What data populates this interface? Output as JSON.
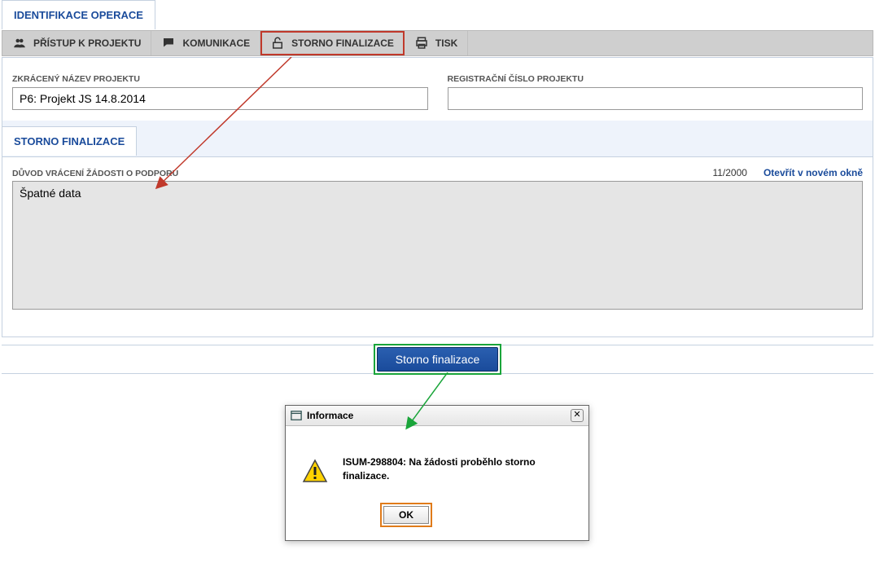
{
  "main_tab": {
    "label": "IDENTIFIKACE OPERACE"
  },
  "toolbar": {
    "items": [
      {
        "label": "PŘÍSTUP K PROJEKTU"
      },
      {
        "label": "KOMUNIKACE"
      },
      {
        "label": "STORNO FINALIZACE"
      },
      {
        "label": "TISK"
      }
    ]
  },
  "form": {
    "short_name_label": "ZKRÁCENÝ NÁZEV PROJEKTU",
    "short_name_value": "P6: Projekt JS 14.8.2014",
    "reg_num_label": "REGISTRAČNÍ ČÍSLO PROJEKTU",
    "reg_num_value": ""
  },
  "storno_tab": {
    "label": "STORNO FINALIZACE"
  },
  "reason": {
    "label": "DŮVOD VRÁCENÍ ŽÁDOSTI O PODPORU",
    "value": "Špatné data",
    "counter": "11/2000",
    "open_new": "Otevřít v novém okně"
  },
  "submit": {
    "label": "Storno finalizace"
  },
  "dialog": {
    "title": "Informace",
    "message": "ISUM-298804: Na žádosti proběhlo storno finalizace.",
    "ok": "OK"
  }
}
